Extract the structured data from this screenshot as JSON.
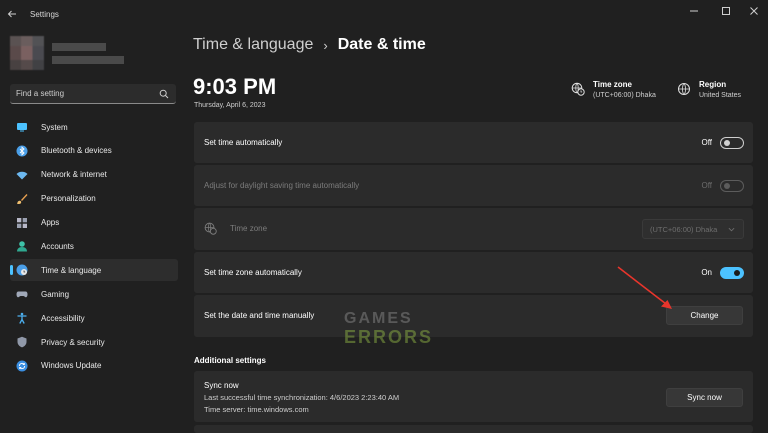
{
  "window": {
    "title": "Settings"
  },
  "search": {
    "placeholder": "Find a setting"
  },
  "sidebar": {
    "items": [
      {
        "label": "System",
        "icon": "monitor-icon"
      },
      {
        "label": "Bluetooth & devices",
        "icon": "bluetooth-icon"
      },
      {
        "label": "Network & internet",
        "icon": "wifi-icon"
      },
      {
        "label": "Personalization",
        "icon": "brush-icon"
      },
      {
        "label": "Apps",
        "icon": "apps-icon"
      },
      {
        "label": "Accounts",
        "icon": "person-icon"
      },
      {
        "label": "Time & language",
        "icon": "clock-globe-icon",
        "active": true
      },
      {
        "label": "Gaming",
        "icon": "gamepad-icon"
      },
      {
        "label": "Accessibility",
        "icon": "accessibility-icon"
      },
      {
        "label": "Privacy & security",
        "icon": "shield-icon"
      },
      {
        "label": "Windows Update",
        "icon": "update-icon"
      }
    ]
  },
  "breadcrumb": {
    "parent": "Time & language",
    "separator": "›",
    "current": "Date & time"
  },
  "clock": {
    "time": "9:03 PM",
    "date": "Thursday, April 6, 2023"
  },
  "header_info": {
    "timezone_title": "Time zone",
    "timezone_value": "(UTC+06:00) Dhaka",
    "region_title": "Region",
    "region_value": "United States"
  },
  "settings": {
    "set_time_auto": {
      "label": "Set time automatically",
      "state": "Off"
    },
    "daylight_saving": {
      "label": "Adjust for daylight saving time automatically",
      "state": "Off"
    },
    "time_zone": {
      "label": "Time zone",
      "value": "(UTC+06:00) Dhaka"
    },
    "set_tz_auto": {
      "label": "Set time zone automatically",
      "state": "On"
    },
    "manual": {
      "label": "Set the date and time manually",
      "button": "Change"
    }
  },
  "additional": {
    "title": "Additional settings",
    "sync_title": "Sync now",
    "sync_last": "Last successful time synchronization: 4/6/2023 2:23:40 AM",
    "sync_server": "Time server: time.windows.com",
    "sync_button": "Sync now"
  },
  "watermark": {
    "line1": "GAMES",
    "line2": "ERRORS"
  },
  "colors": {
    "accent": "#4cc2ff",
    "annotation_arrow": "#e8352c"
  }
}
